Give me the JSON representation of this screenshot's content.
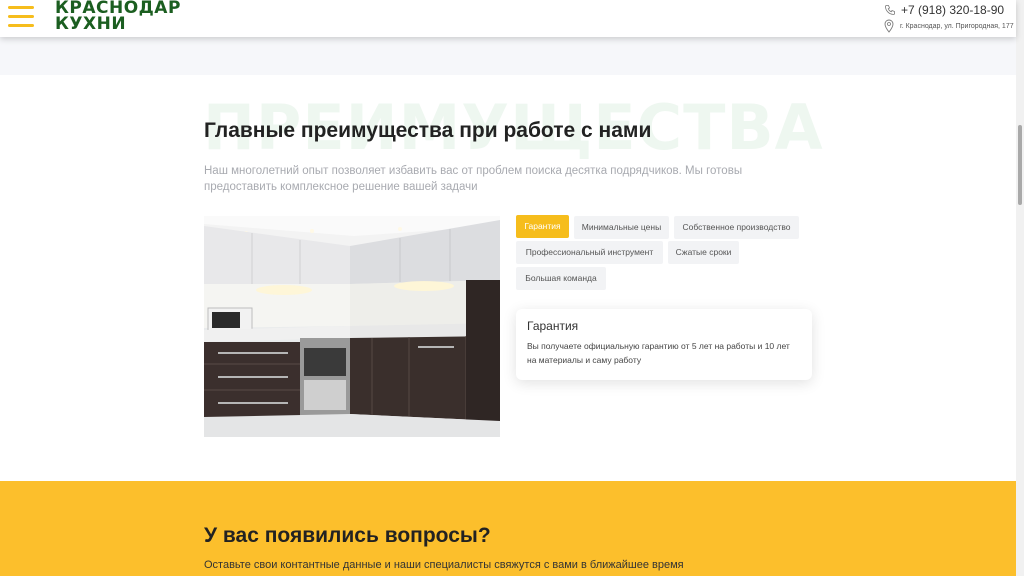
{
  "header": {
    "logo_line1": "КРАСНОДАР",
    "logo_line2": "КУХНИ",
    "phone": "+7 (918) 320-18-90",
    "address": "г. Краснодар, ул. Пригородная, 177",
    "phone_icon": "phone-icon",
    "location_icon": "location-pin-icon",
    "menu_icon": "burger-menu-icon"
  },
  "advantages": {
    "background_word": "ПРЕИМУЩЕСТВА",
    "title": "Главные преимущества при работе с нами",
    "subtitle": "Наш многолетний опыт позволяет избавить вас от проблем поиска десятка подрядчиков. Мы готовы предоставить комплексное решение вашей задачи",
    "tabs": [
      {
        "label": "Гарантия",
        "active": true
      },
      {
        "label": "Минимальные цены",
        "active": false
      },
      {
        "label": "Собственное производство",
        "active": false
      },
      {
        "label": "Профессиональный инструмент",
        "active": false
      },
      {
        "label": "Сжатые сроки",
        "active": false
      },
      {
        "label": "Большая команда",
        "active": false
      }
    ],
    "card": {
      "title": "Гарантия",
      "text": "Вы получаете официальную гарантию от 5 лет на работы и 10 лет на материалы и саму работу"
    }
  },
  "questions": {
    "title": "У вас появились вопросы?",
    "subtitle": "Оставьте свои контантные данные и наши специалисты свяжутся с вами в ближайшее время"
  },
  "colors": {
    "accent": "#f6bd1c",
    "brand_green": "#1b5e20",
    "questions_bg": "#fcbf2c"
  }
}
